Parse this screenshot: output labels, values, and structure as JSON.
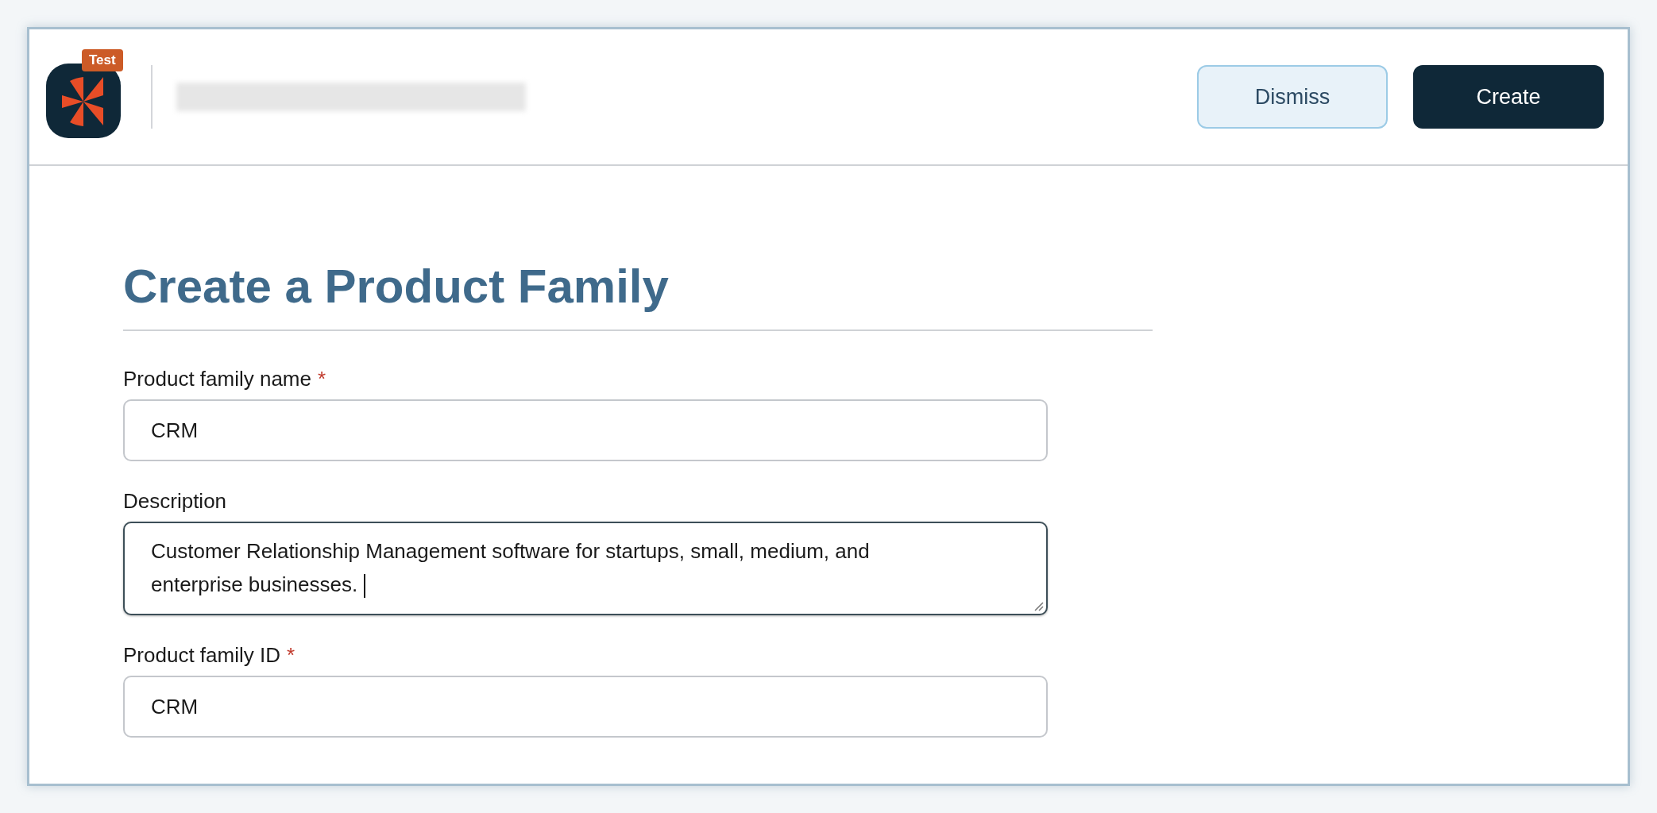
{
  "header": {
    "badge": "Test",
    "buttons": [
      {
        "label": "Dismiss",
        "kind": "secondary"
      },
      {
        "label": "Create",
        "kind": "primary"
      }
    ]
  },
  "form": {
    "title": "Create a Product Family",
    "fields": [
      {
        "label": "Product family name",
        "required_mark": "*",
        "kind": "text",
        "value": "CRM",
        "focused": false
      },
      {
        "label": "Description",
        "kind": "textarea",
        "value": "Customer Relationship Management software for startups, small, medium, and enterprise businesses.",
        "focused": true
      },
      {
        "label": "Product family ID",
        "required_mark": "*",
        "kind": "text",
        "value": "CRM",
        "focused": false
      }
    ]
  }
}
